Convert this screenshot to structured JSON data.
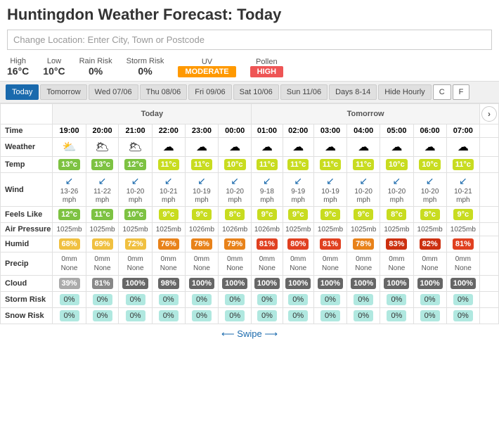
{
  "title": "Huntingdon Weather Forecast: Today",
  "location_placeholder": "Change Location: Enter City, Town or Postcode",
  "summary": {
    "high_label": "High",
    "high_value": "16°C",
    "low_label": "Low",
    "low_value": "10°C",
    "rain_label": "Rain Risk",
    "rain_value": "0%",
    "storm_label": "Storm Risk",
    "storm_value": "0%",
    "uv_label": "UV",
    "uv_badge": "MODERATE",
    "pollen_label": "Pollen",
    "pollen_badge": "HIGH"
  },
  "nav": {
    "tabs": [
      "Today",
      "Tomorrow",
      "Wed 07/06",
      "Thu 08/06",
      "Fri 09/06",
      "Sat 10/06",
      "Sun 11/06",
      "Days 8-14",
      "Hide Hourly"
    ],
    "active": "Today",
    "units": [
      "C",
      "F"
    ]
  },
  "sections": {
    "today_label": "Today",
    "tomorrow_label": "Tomorrow"
  },
  "times": [
    "19:00",
    "20:00",
    "21:00",
    "22:00",
    "23:00",
    "00:00",
    "01:00",
    "02:00",
    "03:00",
    "04:00",
    "05:00",
    "06:00",
    "07:00"
  ],
  "weather_icons": [
    "⛅",
    "🌥",
    "🌥",
    "☁",
    "☁",
    "☁",
    "☁",
    "☁",
    "☁",
    "☁",
    "☁",
    "☁",
    "☁"
  ],
  "temps": [
    "13°c",
    "13°c",
    "12°c",
    "11°c",
    "11°c",
    "10°c",
    "11°c",
    "11°c",
    "11°c",
    "11°c",
    "10°c",
    "10°c",
    "11°c"
  ],
  "temp_colors": [
    "green",
    "green",
    "green",
    "lime",
    "lime",
    "lime",
    "lime",
    "lime",
    "lime",
    "lime",
    "lime",
    "lime",
    "lime"
  ],
  "winds": [
    {
      "dir": "↙",
      "speed": "13-26\nmph"
    },
    {
      "dir": "↙",
      "speed": "11-22\nmph"
    },
    {
      "dir": "↙",
      "speed": "10-20\nmph"
    },
    {
      "dir": "↙",
      "speed": "10-21\nmph"
    },
    {
      "dir": "↙",
      "speed": "10-19\nmph"
    },
    {
      "dir": "↙",
      "speed": "10-20\nmph"
    },
    {
      "dir": "↙",
      "speed": "9-18\nmph"
    },
    {
      "dir": "↙",
      "speed": "9-19\nmph"
    },
    {
      "dir": "↙",
      "speed": "10-19\nmph"
    },
    {
      "dir": "↙",
      "speed": "10-20\nmph"
    },
    {
      "dir": "↙",
      "speed": "10-20\nmph"
    },
    {
      "dir": "↙",
      "speed": "10-20\nmph"
    },
    {
      "dir": "↙",
      "speed": "10-21\nmph"
    }
  ],
  "feels_like": [
    "12°c",
    "11°c",
    "10°c",
    "9°c",
    "9°c",
    "8°c",
    "9°c",
    "9°c",
    "9°c",
    "9°c",
    "8°c",
    "8°c",
    "9°c"
  ],
  "feels_colors": [
    "green",
    "green",
    "green",
    "lime",
    "lime",
    "lime",
    "lime",
    "lime",
    "lime",
    "lime",
    "lime",
    "lime",
    "lime"
  ],
  "pressure": [
    "1025mb",
    "1025mb",
    "1025mb",
    "1025mb",
    "1026mb",
    "1026mb",
    "1026mb",
    "1025mb",
    "1025mb",
    "1025mb",
    "1025mb",
    "1025mb",
    "1025mb"
  ],
  "humidity": [
    "68%",
    "69%",
    "72%",
    "76%",
    "78%",
    "79%",
    "81%",
    "80%",
    "81%",
    "78%",
    "83%",
    "82%",
    "81%"
  ],
  "humid_colors": [
    "yellow",
    "yellow",
    "yellow",
    "orange",
    "orange",
    "orange",
    "red",
    "red",
    "red",
    "orange",
    "red2",
    "red2",
    "red"
  ],
  "precip": [
    "0mm\nNone",
    "0mm\nNone",
    "0mm\nNone",
    "0mm\nNone",
    "0mm\nNone",
    "0mm\nNone",
    "0mm\nNone",
    "0mm\nNone",
    "0mm\nNone",
    "0mm\nNone",
    "0mm\nNone",
    "0mm\nNone",
    "0mm\nNone"
  ],
  "cloud": [
    "39%",
    "81%",
    "100%",
    "98%",
    "100%",
    "100%",
    "100%",
    "100%",
    "100%",
    "100%",
    "100%",
    "100%",
    "100%"
  ],
  "cloud_colors": [
    "light",
    "mid",
    "dark",
    "dark",
    "dark",
    "dark",
    "dark",
    "dark",
    "dark",
    "dark",
    "dark",
    "dark",
    "dark"
  ],
  "storm_risk": [
    "0%",
    "0%",
    "0%",
    "0%",
    "0%",
    "0%",
    "0%",
    "0%",
    "0%",
    "0%",
    "0%",
    "0%",
    "0%"
  ],
  "snow_risk": [
    "0%",
    "0%",
    "0%",
    "0%",
    "0%",
    "0%",
    "0%",
    "0%",
    "0%",
    "0%",
    "0%",
    "0%",
    "0%"
  ],
  "swipe_label": "⟵  Swipe  ⟶"
}
